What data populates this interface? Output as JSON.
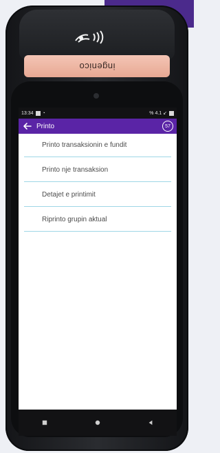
{
  "device": {
    "brand_label": "ingenico",
    "contactless_symbol": "contactless-logo"
  },
  "status_bar": {
    "time": "13:34",
    "signal_text": "% 4.1 ↙"
  },
  "app_bar": {
    "title": "Printo",
    "counter": "57"
  },
  "menu": {
    "items": [
      {
        "label": "Printo transaksionin e fundit"
      },
      {
        "label": "Printo nje transaksion"
      },
      {
        "label": "Detajet e printimit"
      },
      {
        "label": "Riprinto grupin aktual"
      }
    ]
  },
  "colors": {
    "app_bar": "#5a24a6",
    "divider": "#9ed6e6",
    "label_pink": "#f0b9a6",
    "device_body": "#1f2124",
    "background_accent": "#4b2a8c"
  }
}
